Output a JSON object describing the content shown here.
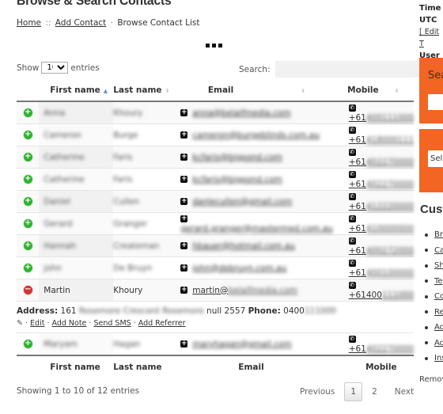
{
  "page": {
    "title": "Browse & Search Contacts",
    "breadcrumb": {
      "home": "Home",
      "sep1": "::",
      "add_contact": "Add Contact",
      "sep2": "·",
      "current": "Browse Contact List"
    }
  },
  "controls": {
    "show_label": "Show",
    "entries_value": "10",
    "entries_label": "entries",
    "search_label": "Search:",
    "search_value": ""
  },
  "table": {
    "columns": [
      "",
      "First name",
      "Last name",
      "Email",
      "Mobile"
    ],
    "rows": [
      {
        "first": "Anna",
        "last": "Khoury",
        "email": "anna@belaifmedia.com",
        "mobile_prefix": "+61",
        "mobile_rest": "400111000",
        "expanded": false
      },
      {
        "first": "Cameron",
        "last": "Burge",
        "email": "cameron@burgeblinds.com.au",
        "mobile_prefix": "+61",
        "mobile_rest": "418000111",
        "expanded": false
      },
      {
        "first": "Catherine",
        "last": "Faris",
        "email": "kcfaris@bigpond.com",
        "mobile_prefix": "+61",
        "mobile_rest": "402270000",
        "expanded": false
      },
      {
        "first": "Catherine",
        "last": "Faris",
        "email": "kcfaris@bigpond.com",
        "mobile_prefix": "+61",
        "mobile_rest": "402270000",
        "expanded": false
      },
      {
        "first": "Daniel",
        "last": "Cullen",
        "email": "danlecullen@gmail.com",
        "mobile_prefix": "+61",
        "mobile_rest": "412220000",
        "expanded": false
      },
      {
        "first": "Gerard",
        "last": "Granger",
        "email": "gerard.granger@mastermed.com.au",
        "mobile_prefix": "+61",
        "mobile_rest": "410000000",
        "expanded": false
      },
      {
        "first": "Hannah",
        "last": "Createman",
        "email": "hbauer@hotmail.com.au",
        "mobile_prefix": "+61",
        "mobile_rest": "400272000",
        "expanded": false
      },
      {
        "first": "john",
        "last": "De Bruyn",
        "email": "john@debruyn.com.au",
        "mobile_prefix": "+61",
        "mobile_rest": "400100000",
        "expanded": false
      },
      {
        "first": "Martin",
        "last": "Khoury",
        "email_visible": "martin@",
        "email": "belaifmedia.com",
        "mobile_prefix": "+61400",
        "mobile_rest": "111000",
        "expanded": true
      },
      {
        "first": "Maryam",
        "last": "Hagan",
        "email": "maryhagan@gmail.com",
        "mobile_prefix": "+61",
        "mobile_rest": "402270000",
        "expanded": false
      }
    ],
    "child": {
      "address_label": "Address:",
      "address_visible": "161",
      "address_blurred": "Rosemore Crescent Rosemore",
      "address_tail": "null 2557",
      "phone_label": "Phone:",
      "phone_visible": "0400",
      "phone_blurred": "111000",
      "actions": [
        "Edit",
        "Add Note",
        "Send SMS",
        "Add Referrer"
      ]
    }
  },
  "footer": {
    "info": "Showing 1 to 10 of 12 entries",
    "pagination": {
      "previous": "Previous",
      "pages": [
        "1",
        "2"
      ],
      "current": "1",
      "next": "Next"
    }
  },
  "sidebar": {
    "time_label": "Time",
    "tz": "UTC",
    "edit_time": "[ Edit T",
    "user_label": "User",
    "search_label": "Sea",
    "select_label": "Sel",
    "custom_heading": "Cust",
    "links": [
      "Br",
      "Ca",
      "Sh",
      "Te",
      "Co",
      "Re",
      "Ad",
      "Ad",
      "Ins"
    ],
    "remove_text": "Remov",
    "accent_color": "#f26522"
  }
}
